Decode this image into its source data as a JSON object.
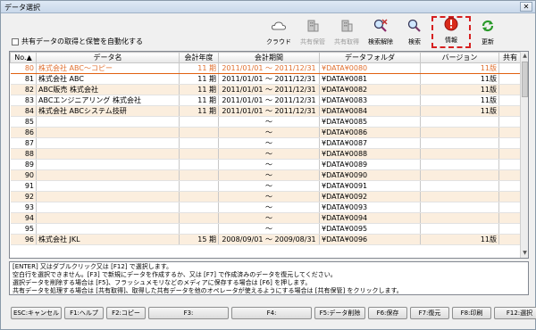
{
  "window": {
    "title": "データ選択",
    "close": "✕"
  },
  "auto_option": {
    "label": "共有データの取得と保管を自動化する"
  },
  "toolbar": [
    {
      "id": "cloud",
      "label": "クラウド",
      "icon": "cloud-icon",
      "disabled": false
    },
    {
      "id": "share-save",
      "label": "共有保管",
      "icon": "building-icon",
      "disabled": true
    },
    {
      "id": "share-get",
      "label": "共有取得",
      "icon": "building-icon",
      "disabled": true
    },
    {
      "id": "search-clear",
      "label": "検索解除",
      "icon": "search-clear-icon",
      "disabled": false
    },
    {
      "id": "search",
      "label": "検索",
      "icon": "search-icon",
      "disabled": false
    },
    {
      "id": "info",
      "label": "情報",
      "icon": "info-icon",
      "disabled": false,
      "selected": true
    },
    {
      "id": "update",
      "label": "更新",
      "icon": "refresh-icon",
      "disabled": false
    }
  ],
  "table": {
    "headers": [
      "No.▲",
      "データ名",
      "会計年度",
      "会計期間",
      "データフォルダ",
      "バージョン",
      "共有"
    ],
    "rows": [
      [
        "80",
        "株式会社 ABC～コピー",
        "11 期",
        "2011/01/01 ～ 2011/12/31",
        "¥DATA¥0080",
        "11版",
        ""
      ],
      [
        "81",
        "株式会社 ABC",
        "11 期",
        "2011/01/01 ～ 2011/12/31",
        "¥DATA¥0081",
        "11版",
        ""
      ],
      [
        "82",
        "ABC販売 株式会社",
        "11 期",
        "2011/01/01 ～ 2011/12/31",
        "¥DATA¥0082",
        "11版",
        ""
      ],
      [
        "83",
        "ABCエンジニアリング 株式会社",
        "11 期",
        "2011/01/01 ～ 2011/12/31",
        "¥DATA¥0083",
        "11版",
        ""
      ],
      [
        "84",
        "株式会社 ABCシステム技研",
        "11 期",
        "2011/01/01 ～ 2011/12/31",
        "¥DATA¥0084",
        "11版",
        ""
      ],
      [
        "85",
        "",
        "",
        "～",
        "¥DATA¥0085",
        "",
        ""
      ],
      [
        "86",
        "",
        "",
        "～",
        "¥DATA¥0086",
        "",
        ""
      ],
      [
        "87",
        "",
        "",
        "～",
        "¥DATA¥0087",
        "",
        ""
      ],
      [
        "88",
        "",
        "",
        "～",
        "¥DATA¥0088",
        "",
        ""
      ],
      [
        "89",
        "",
        "",
        "～",
        "¥DATA¥0089",
        "",
        ""
      ],
      [
        "90",
        "",
        "",
        "～",
        "¥DATA¥0090",
        "",
        ""
      ],
      [
        "91",
        "",
        "",
        "～",
        "¥DATA¥0091",
        "",
        ""
      ],
      [
        "92",
        "",
        "",
        "～",
        "¥DATA¥0092",
        "",
        ""
      ],
      [
        "93",
        "",
        "",
        "～",
        "¥DATA¥0093",
        "",
        ""
      ],
      [
        "94",
        "",
        "",
        "～",
        "¥DATA¥0094",
        "",
        ""
      ],
      [
        "95",
        "",
        "",
        "～",
        "¥DATA¥0095",
        "",
        ""
      ],
      [
        "96",
        "株式会社 JKL",
        "15 期",
        "2008/09/01 ～ 2009/08/31",
        "¥DATA¥0096",
        "11版",
        ""
      ]
    ],
    "selected_row": 0
  },
  "messages": [
    "[ENTER] 又はダブルクリック又は [F12] で選択します。",
    "空白行を選択できません。[F3] で新規にデータを作成するか、又は [F7] で作成済みのデータを復元してください。",
    "選択データを削除する場合は [F5]、フラッシュメモリなどのメディアに保存する場合は [F6] を押します。",
    "共有データを処理する場合は [共有取得]、取得した共有データを他のオペレータが使えるようにする場合は [共有保管] をクリックします。"
  ],
  "fkeys": [
    {
      "label": "ESC:キャンセル"
    },
    {
      "label": "F1:ヘルプ"
    },
    {
      "label": "F2:コピー"
    },
    {
      "label": "F3:"
    },
    {
      "label": "F4:"
    },
    {
      "label": "F5:データ削除"
    },
    {
      "label": "F6:保存"
    },
    {
      "label": "F7:復元"
    },
    {
      "label": "F8:印刷"
    },
    {
      "label": "F12:選択"
    }
  ]
}
